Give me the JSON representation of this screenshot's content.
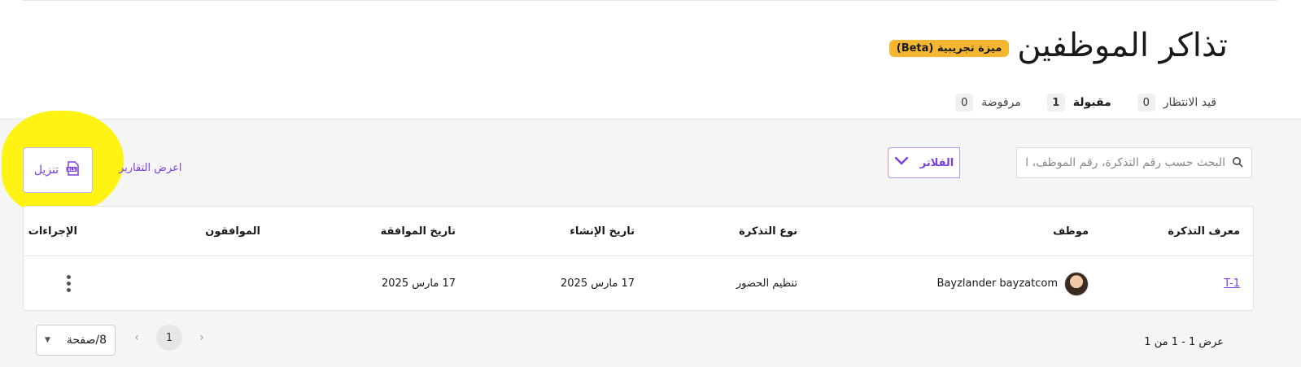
{
  "header": {
    "title": "تذاكر الموظفين",
    "beta_badge": "ميزة تجريبية (Beta)"
  },
  "tabs": [
    {
      "label": "قيد الانتظار",
      "count": "0",
      "active": false
    },
    {
      "label": "مقبولة",
      "count": "1",
      "active": true
    },
    {
      "label": "مرفوضة",
      "count": "0",
      "active": false
    }
  ],
  "toolbar": {
    "search_placeholder": "البحث حسب رقم التذكرة، رقم الموظف، الاسم",
    "filters_label": "الفلاتر",
    "reports_link": "اعرض التقارير",
    "download_label": "تنزيل"
  },
  "table": {
    "columns": {
      "ticket_id": "معرف التذكرة",
      "employee": "موظف",
      "ticket_type": "نوع التذكرة",
      "created_date": "تاريخ الإنشاء",
      "approval_date": "تاريخ الموافقة",
      "approvers": "الموافقون",
      "actions": "الإجراءات"
    },
    "rows": [
      {
        "ticket_id": "T-1",
        "employee": "Bayzlander bayzatcom",
        "ticket_type": "تنظيم الحضور",
        "created_date": "17 مارس 2025",
        "approval_date": "17 مارس 2025",
        "approvers": ""
      }
    ]
  },
  "pagination": {
    "summary": "عرض 1 - 1 من 1",
    "current_page": "1",
    "per_page": "8/صفحة"
  },
  "colors": {
    "accent": "#7b3fe4",
    "beta_badge": "#f5b731",
    "highlight": "#fff200"
  },
  "icons": {
    "search": "search-icon",
    "filters": "chevron-down-icon",
    "download": "xls-file-icon",
    "actions": "kebab-menu-icon"
  }
}
